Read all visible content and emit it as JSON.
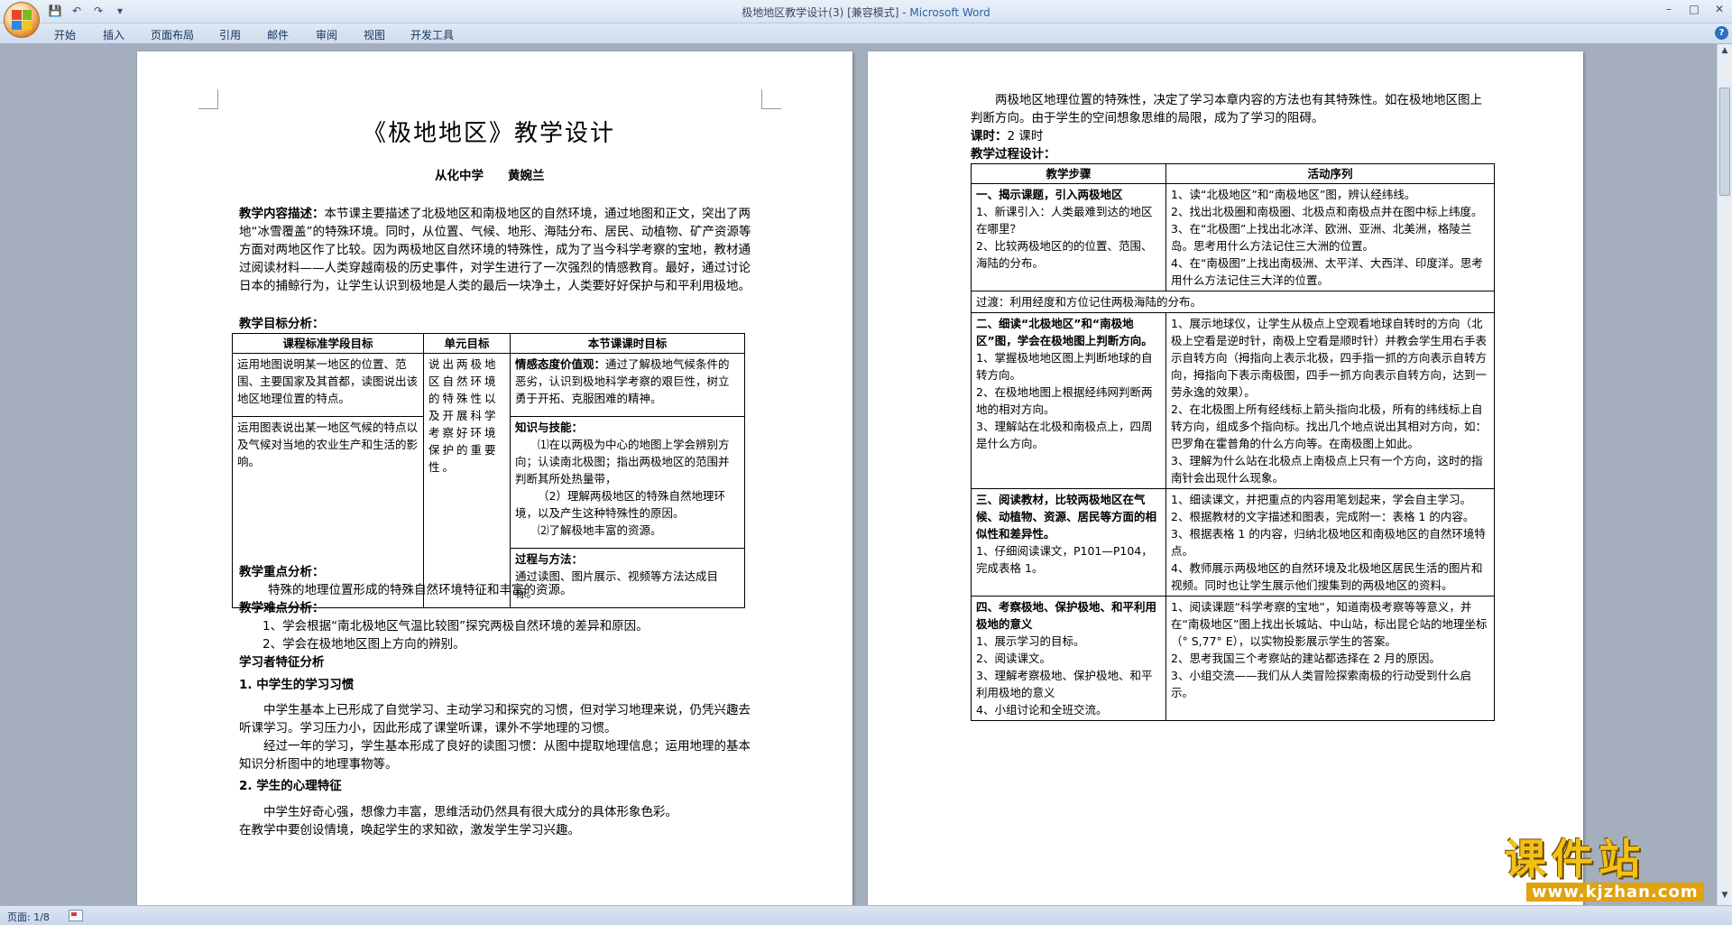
{
  "window": {
    "title": "极地地区教学设计(3) [兼容模式] - ",
    "app_name": "Microsoft Word",
    "minimize": "–",
    "maximize": "□",
    "close": "✕"
  },
  "quick_access": {
    "save_icon": "💾",
    "undo_icon": "↶",
    "redo_icon": "↷",
    "more_icon": "▾"
  },
  "ribbon": {
    "tabs": [
      "开始",
      "插入",
      "页面布局",
      "引用",
      "邮件",
      "审阅",
      "视图",
      "开发工具"
    ],
    "help": "?"
  },
  "left_page": {
    "title": "《极地地区》教学设计",
    "author": "从化中学　　黄婉兰",
    "content_desc_label": "教学内容描述：",
    "content_desc": "本节课主要描述了北极地区和南极地区的自然环境，通过地图和正文，突出了两地“冰雪覆盖”的特殊环境。同时，从位置、气候、地形、海陆分布、居民、动植物、矿产资源等方面对两地区作了比较。因为两极地区自然环境的特殊性，成为了当今科学考察的宝地，教材通过阅读材料——人类穿越南极的历史事件，对学生进行了一次强烈的情感教育。最好，通过讨论日本的捕鲸行为，让学生认识到极地是人类的最后一块净土，人类要好好保护与和平利用极地。",
    "goal_label": "教学目标分析：",
    "goal_table": {
      "headers": [
        "课程标准学段目标",
        "单元目标",
        "本节课课时目标"
      ],
      "std_goal_1": "运用地图说明某一地区的位置、范围、主要国家及其首都，读图说出该地区地理位置的特点。",
      "std_goal_2": "运用图表说出某一地区气候的特点以及气候对当地的农业生产和生活的影响。",
      "unit_goal": "说出两极地区自然环境的特殊性以及开展科学考察好环境保护的重要性。",
      "emotion_title": "情感态度价值观：",
      "emotion_text": "通过了解极地气候条件的恶劣，认识到极地科学考察的艰巨性，树立勇于开拓、克服困难的精神。",
      "knowledge_title": "知识与技能：",
      "knowledge_1": "⑴在以两极为中心的地图上学会辨别方向；认读南北极图；指出两极地区的范围并判断其所处热量带，",
      "knowledge_2": "（2）理解两极地区的特殊自然地理环境，以及产生这种特殊性的原因。",
      "knowledge_3": "⑵了解极地丰富的资源。",
      "process_title": "过程与方法：",
      "process_text": "通过读图、图片展示、视频等方法达成目标。"
    },
    "key_label": "教学重点分析：",
    "key_text": "特殊的地理位置形成的特殊自然环境特征和丰富的资源。",
    "difficulty_label": "教学难点分析：",
    "difficulty_1": "1、学会根据“南北极地区气温比较图”探究两极自然环境的差异和原因。",
    "difficulty_2": "2、学会在极地地区图上方向的辨别。",
    "learner_label": "学习者特征分析",
    "habit_title": "1. 中学生的学习习惯",
    "habit_1": "中学生基本上已形成了自觉学习、主动学习和探究的习惯，但对学习地理来说，仍凭兴趣去听课学习。学习压力小，因此形成了课堂听课，课外不学地理的习惯。",
    "habit_2": "经过一年的学习，学生基本形成了良好的读图习惯：从图中提取地理信息；运用地理的基本知识分析图中的地理事物等。",
    "psych_title": "2. 学生的心理特征",
    "psych_1": "中学生好奇心强，想像力丰富，思维活动仍然具有很大成分的具体形象色彩。",
    "psych_2": "在教学中要创设情境，唤起学生的求知欲，激发学生学习兴趣。"
  },
  "right_page": {
    "intro": "两极地区地理位置的特殊性，决定了学习本章内容的方法也有其特殊性。如在极地地区图上判断方向。由于学生的空间想象思维的局限，成为了学习的阻碍。",
    "period_label": "课时：",
    "period_value": "2 课时",
    "process_label": "教学过程设计：",
    "table_headers": [
      "教学步骤",
      "活动序列"
    ],
    "step1_title": "一、揭示课题，引入两极地区",
    "step1_text": "1、新课引入：人类最难到达的地区在哪里？\n2、比较两极地区的的位置、范围、海陆的分布。",
    "act1_text": "1、读“北极地区”和“南极地区”图，辨认经纬线。\n2、找出北极圈和南极圈、北极点和南极点并在图中标上纬度。\n3、在“北极图”上找出北冰洋、欧洲、亚洲、北美洲，格陵兰岛。思考用什么方法记住三大洲的位置。\n4、在“南极图”上找出南极洲、太平洋、大西洋、印度洋。思考用什么方法记住三大洋的位置。",
    "transition": "过渡：利用经度和方位记住两极海陆的分布。",
    "step2_title": "二、细读“北极地区”和“南极地区”图，学会在极地图上判断方向。",
    "step2_text": "1、掌握极地地区图上判断地球的自转方向。\n2、在极地地图上根据经纬网判断两地的相对方向。\n3、理解站在北极和南极点上，四周是什么方向。",
    "act2_text": "1、展示地球仪，让学生从极点上空观看地球自转时的方向（北极上空看是逆时针，南极上空看是顺时针）并教会学生用右手表示自转方向（拇指向上表示北极，四手指一抓的方向表示自转方向，拇指向下表示南极图，四手一抓方向表示自转方向，达到一劳永逸的效果）。\n2、在北极图上所有经线标上箭头指向北极，所有的纬线标上自转方向，组成多个指向标。找出几个地点说出其相对方向，如：巴罗角在霍普角的什么方向等。在南极图上如此。\n3、理解为什么站在北极点上南极点上只有一个方向，这时的指南针会出现什么现象。",
    "step3_title": "三、阅读教材，比较两极地区在气候、动植物、资源、居民等方面的相似性和差异性。",
    "step3_text": "1、仔细阅读课文，P101—P104，完成表格 1。",
    "act3_text": "1、细读课文，并把重点的内容用笔划起来，学会自主学习。\n2、根据教材的文字描述和图表，完成附一：表格 1 的内容。\n3、根据表格 1 的内容，归纳北极地区和南极地区的自然环境特点。\n4、教师展示两极地区的自然环境及北极地区居民生活的图片和视频。同时也让学生展示他们搜集到的两极地区的资料。",
    "step4_title": "四、考察极地、保护极地、和平利用极地的意义",
    "step4_text": "1、展示学习的目标。\n2、阅读课文。\n3、理解考察极地、保护极地、和平利用极地的意义\n4、小组讨论和全班交流。",
    "act4_text": "1、阅读课题“科学考察的宝地”，知道南极考察等等意义，并在“南极地区”图上找出长城站、中山站，标出昆仑站的地理坐标（° S,77° E），以实物投影展示学生的答案。\n2、思考我国三个考察站的建站都选择在 2 月的原因。\n3、小组交流——我们从人类冒险探索南极的行动受到什么启示。"
  },
  "status_bar": {
    "page_info": "页面: 1/8"
  },
  "watermark": {
    "main": "课件站",
    "url": "www.kjzhan.com"
  },
  "colors": {
    "ribbon_bg": "#dfe9f5",
    "workspace_bg": "#a4aebc",
    "watermark_yellow": "#f3c017",
    "app_name_blue": "#2e5fa8"
  }
}
